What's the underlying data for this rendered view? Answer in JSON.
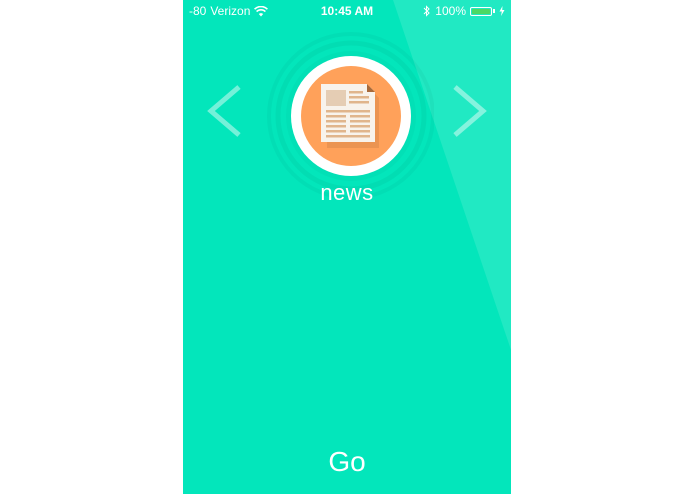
{
  "status_bar": {
    "signal": "-80",
    "carrier": "Verizon",
    "time": "10:45 AM",
    "battery_percent": "100%",
    "battery_level": 1.0
  },
  "carousel": {
    "category_label": "news",
    "icon": "newspaper-icon",
    "prev_icon": "chevron-left-icon",
    "next_icon": "chevron-right-icon"
  },
  "action": {
    "go_label": "Go"
  },
  "colors": {
    "background": "#03e6bb",
    "icon_accent": "#ffa15a",
    "battery_green": "#4cd964"
  }
}
